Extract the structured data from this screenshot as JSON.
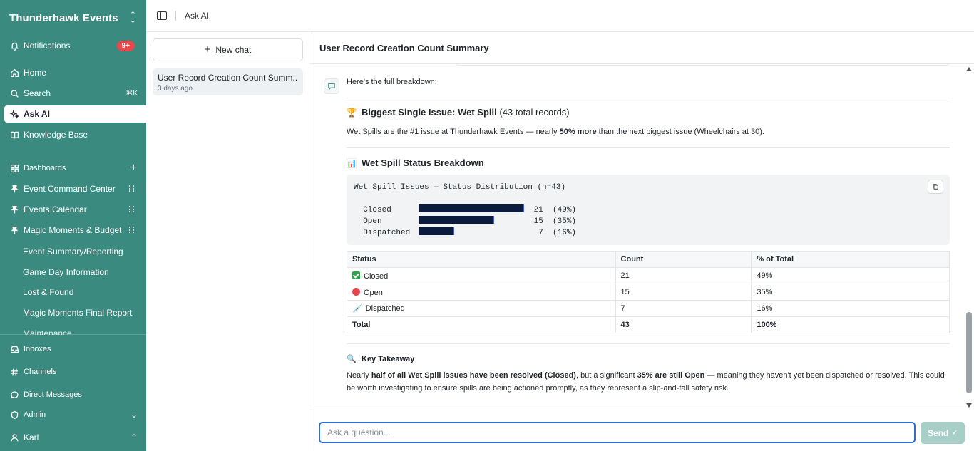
{
  "workspace": {
    "name": "Thunderhawk Events"
  },
  "sidebar": {
    "notifications": {
      "label": "Notifications",
      "badge": "9+"
    },
    "items": [
      {
        "label": "Home",
        "icon": "home-icon"
      },
      {
        "label": "Search",
        "icon": "search-icon",
        "shortcut": "⌘K"
      },
      {
        "label": "Ask AI",
        "icon": "sparkle-icon"
      },
      {
        "label": "Knowledge Base",
        "icon": "book-icon"
      }
    ],
    "dashboards": {
      "label": "Dashboards",
      "pinned": [
        "Event Command Center",
        "Events Calendar",
        "Magic Moments & Budget"
      ],
      "others": [
        "Event Summary/Reporting",
        "Game Day Information",
        "Lost & Found",
        "Magic Moments Final Report",
        "Maintenance"
      ]
    },
    "bottom": [
      {
        "label": "Inboxes",
        "icon": "inbox-icon"
      },
      {
        "label": "Channels",
        "icon": "hash-icon"
      },
      {
        "label": "Direct Messages",
        "icon": "message-icon"
      },
      {
        "label": "Admin",
        "icon": "shield-icon"
      },
      {
        "label": "Karl",
        "icon": "user-icon"
      }
    ]
  },
  "topbar": {
    "breadcrumb": "Ask AI"
  },
  "chatlist": {
    "new_chat": "New chat",
    "items": [
      {
        "title": "User Record Creation Count Summ...",
        "date": "3 days ago"
      }
    ]
  },
  "chat": {
    "title": "User Record Creation Count Summary",
    "intro": "Here's the full breakdown:",
    "section1": {
      "emoji": "🏆",
      "title_prefix": "Biggest Single Issue: ",
      "title_bold": "Wet Spill",
      "title_suffix": " (43 total records)",
      "text_a": "Wet Spills are the #1 issue at Thunderhawk Events — nearly ",
      "text_bold": "50% more",
      "text_b": " than the next biggest issue (Wheelchairs at 30)."
    },
    "section2": {
      "emoji": "📊",
      "title": "Wet Spill Status Breakdown",
      "code_title": "Wet Spill Issues — Status Distribution (n=43)",
      "code_rows": [
        {
          "label": "Closed    ",
          "count": "21",
          "pct": "(49%)",
          "value": 21
        },
        {
          "label": "Open      ",
          "count": "15",
          "pct": "(35%)",
          "value": 15
        },
        {
          "label": "Dispatched",
          "count": " 7",
          "pct": "(16%)",
          "value": 7
        }
      ],
      "table_headers": [
        "Status",
        "Count",
        "% of Total"
      ],
      "table_rows": [
        {
          "status": "Closed",
          "icon": "check-icon",
          "count": "21",
          "pct": "49%"
        },
        {
          "status": "Open",
          "icon": "red-circle-icon",
          "count": "15",
          "pct": "35%"
        },
        {
          "status": "Dispatched",
          "icon": "syringe-icon",
          "count": "7",
          "pct": "16%"
        }
      ],
      "total": {
        "label": "Total",
        "count": "43",
        "pct": "100%"
      }
    },
    "section3": {
      "emoji": "🔍",
      "title": "Key Takeaway",
      "t1": "Nearly ",
      "b1": "half of all Wet Spill issues have been resolved (Closed)",
      "t2": ", but a significant ",
      "b2": "35% are still Open",
      "t3": " — meaning they haven't yet been dispatched or resolved. This could be worth investigating to ensure spills are being actioned promptly, as they represent a slip-and-fall safety risk."
    }
  },
  "composer": {
    "placeholder": "Ask a question...",
    "send_label": "Send"
  },
  "colors": {
    "sidebar": "#3b8a7f",
    "accent": "#2f6fd1",
    "badge": "#e5484d",
    "send_disabled": "#a7cfc7"
  }
}
